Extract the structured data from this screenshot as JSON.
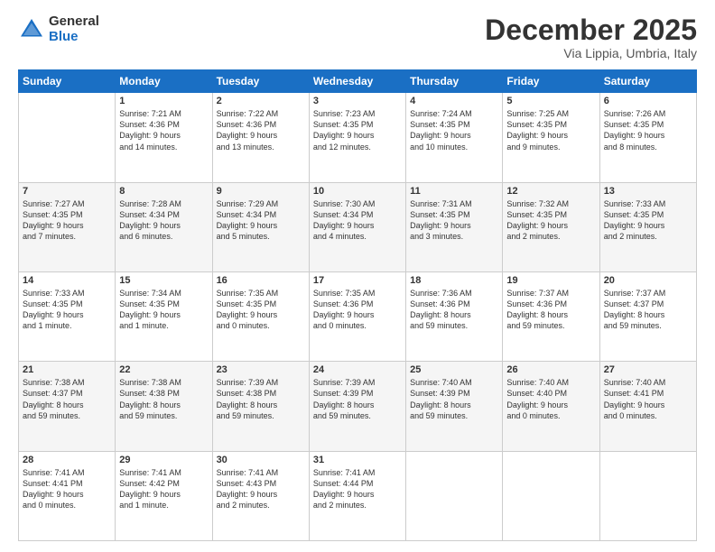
{
  "header": {
    "logo_general": "General",
    "logo_blue": "Blue",
    "month": "December 2025",
    "location": "Via Lippia, Umbria, Italy"
  },
  "days_of_week": [
    "Sunday",
    "Monday",
    "Tuesday",
    "Wednesday",
    "Thursday",
    "Friday",
    "Saturday"
  ],
  "weeks": [
    [
      {
        "day": "",
        "info": ""
      },
      {
        "day": "1",
        "info": "Sunrise: 7:21 AM\nSunset: 4:36 PM\nDaylight: 9 hours\nand 14 minutes."
      },
      {
        "day": "2",
        "info": "Sunrise: 7:22 AM\nSunset: 4:36 PM\nDaylight: 9 hours\nand 13 minutes."
      },
      {
        "day": "3",
        "info": "Sunrise: 7:23 AM\nSunset: 4:35 PM\nDaylight: 9 hours\nand 12 minutes."
      },
      {
        "day": "4",
        "info": "Sunrise: 7:24 AM\nSunset: 4:35 PM\nDaylight: 9 hours\nand 10 minutes."
      },
      {
        "day": "5",
        "info": "Sunrise: 7:25 AM\nSunset: 4:35 PM\nDaylight: 9 hours\nand 9 minutes."
      },
      {
        "day": "6",
        "info": "Sunrise: 7:26 AM\nSunset: 4:35 PM\nDaylight: 9 hours\nand 8 minutes."
      }
    ],
    [
      {
        "day": "7",
        "info": "Sunrise: 7:27 AM\nSunset: 4:35 PM\nDaylight: 9 hours\nand 7 minutes."
      },
      {
        "day": "8",
        "info": "Sunrise: 7:28 AM\nSunset: 4:34 PM\nDaylight: 9 hours\nand 6 minutes."
      },
      {
        "day": "9",
        "info": "Sunrise: 7:29 AM\nSunset: 4:34 PM\nDaylight: 9 hours\nand 5 minutes."
      },
      {
        "day": "10",
        "info": "Sunrise: 7:30 AM\nSunset: 4:34 PM\nDaylight: 9 hours\nand 4 minutes."
      },
      {
        "day": "11",
        "info": "Sunrise: 7:31 AM\nSunset: 4:35 PM\nDaylight: 9 hours\nand 3 minutes."
      },
      {
        "day": "12",
        "info": "Sunrise: 7:32 AM\nSunset: 4:35 PM\nDaylight: 9 hours\nand 2 minutes."
      },
      {
        "day": "13",
        "info": "Sunrise: 7:33 AM\nSunset: 4:35 PM\nDaylight: 9 hours\nand 2 minutes."
      }
    ],
    [
      {
        "day": "14",
        "info": "Sunrise: 7:33 AM\nSunset: 4:35 PM\nDaylight: 9 hours\nand 1 minute."
      },
      {
        "day": "15",
        "info": "Sunrise: 7:34 AM\nSunset: 4:35 PM\nDaylight: 9 hours\nand 1 minute."
      },
      {
        "day": "16",
        "info": "Sunrise: 7:35 AM\nSunset: 4:35 PM\nDaylight: 9 hours\nand 0 minutes."
      },
      {
        "day": "17",
        "info": "Sunrise: 7:35 AM\nSunset: 4:36 PM\nDaylight: 9 hours\nand 0 minutes."
      },
      {
        "day": "18",
        "info": "Sunrise: 7:36 AM\nSunset: 4:36 PM\nDaylight: 8 hours\nand 59 minutes."
      },
      {
        "day": "19",
        "info": "Sunrise: 7:37 AM\nSunset: 4:36 PM\nDaylight: 8 hours\nand 59 minutes."
      },
      {
        "day": "20",
        "info": "Sunrise: 7:37 AM\nSunset: 4:37 PM\nDaylight: 8 hours\nand 59 minutes."
      }
    ],
    [
      {
        "day": "21",
        "info": "Sunrise: 7:38 AM\nSunset: 4:37 PM\nDaylight: 8 hours\nand 59 minutes."
      },
      {
        "day": "22",
        "info": "Sunrise: 7:38 AM\nSunset: 4:38 PM\nDaylight: 8 hours\nand 59 minutes."
      },
      {
        "day": "23",
        "info": "Sunrise: 7:39 AM\nSunset: 4:38 PM\nDaylight: 8 hours\nand 59 minutes."
      },
      {
        "day": "24",
        "info": "Sunrise: 7:39 AM\nSunset: 4:39 PM\nDaylight: 8 hours\nand 59 minutes."
      },
      {
        "day": "25",
        "info": "Sunrise: 7:40 AM\nSunset: 4:39 PM\nDaylight: 8 hours\nand 59 minutes."
      },
      {
        "day": "26",
        "info": "Sunrise: 7:40 AM\nSunset: 4:40 PM\nDaylight: 9 hours\nand 0 minutes."
      },
      {
        "day": "27",
        "info": "Sunrise: 7:40 AM\nSunset: 4:41 PM\nDaylight: 9 hours\nand 0 minutes."
      }
    ],
    [
      {
        "day": "28",
        "info": "Sunrise: 7:41 AM\nSunset: 4:41 PM\nDaylight: 9 hours\nand 0 minutes."
      },
      {
        "day": "29",
        "info": "Sunrise: 7:41 AM\nSunset: 4:42 PM\nDaylight: 9 hours\nand 1 minute."
      },
      {
        "day": "30",
        "info": "Sunrise: 7:41 AM\nSunset: 4:43 PM\nDaylight: 9 hours\nand 2 minutes."
      },
      {
        "day": "31",
        "info": "Sunrise: 7:41 AM\nSunset: 4:44 PM\nDaylight: 9 hours\nand 2 minutes."
      },
      {
        "day": "",
        "info": ""
      },
      {
        "day": "",
        "info": ""
      },
      {
        "day": "",
        "info": ""
      }
    ]
  ]
}
